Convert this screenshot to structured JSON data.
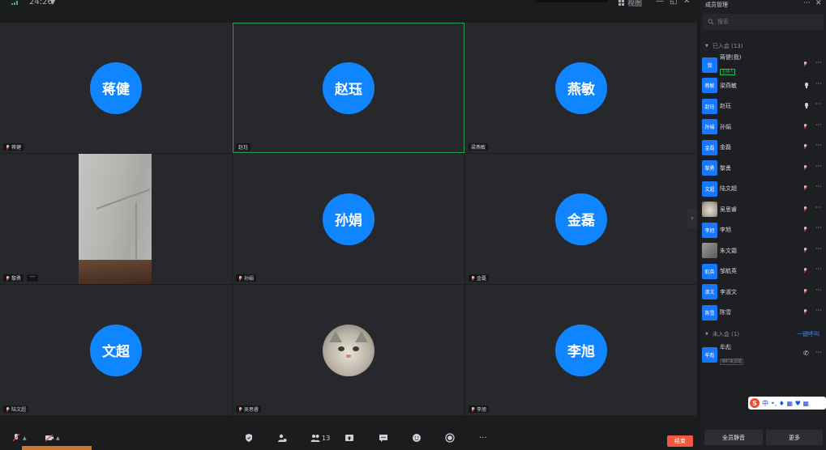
{
  "topbar": {
    "duration": "24:26",
    "view_label": "视图",
    "minimize": "—",
    "restore": "◱",
    "close": "✕"
  },
  "tiles": [
    {
      "name": "蒋健",
      "avatar_text": "蒋健",
      "tag": "蒋健"
    },
    {
      "name": "赵珏",
      "avatar_text": "赵珏",
      "tag": "赵珏"
    },
    {
      "name": "燕敏",
      "avatar_text": "燕敏",
      "tag": "梁燕敏"
    },
    {
      "name": "黎勇",
      "avatar_text": "",
      "tag": "黎勇"
    },
    {
      "name": "孙娟",
      "avatar_text": "孙娟",
      "tag": "孙娟"
    },
    {
      "name": "金磊",
      "avatar_text": "金磊",
      "tag": "金磊"
    },
    {
      "name": "文超",
      "avatar_text": "文超",
      "tag": "陆文超"
    },
    {
      "name": "吴思睿",
      "avatar_text": "",
      "tag": "吴思睿"
    },
    {
      "name": "李旭",
      "avatar_text": "李旭",
      "tag": "李旭"
    }
  ],
  "toolbar": {
    "participants_count": "13",
    "end_label": "结束",
    "more_glyph": "···"
  },
  "panel": {
    "title": "成员管理",
    "more": "···",
    "close": "✕",
    "search_placeholder": "搜索",
    "joined_header": "已入会 (13)",
    "not_joined_header": "未入会 (1)",
    "call_all": "一键呼叫",
    "members": [
      {
        "avatar": "我",
        "name": "蒋健(我)",
        "role": "主持人",
        "mic": "muted"
      },
      {
        "avatar": "燕敏",
        "name": "梁燕敏",
        "role": "",
        "mic": "on"
      },
      {
        "avatar": "赵珏",
        "name": "赵珏",
        "role": "",
        "mic": "on"
      },
      {
        "avatar": "孙娟",
        "name": "孙娟",
        "role": "",
        "mic": "muted"
      },
      {
        "avatar": "金磊",
        "name": "金磊",
        "role": "",
        "mic": "muted"
      },
      {
        "avatar": "黎勇",
        "name": "黎勇",
        "role": "",
        "mic": "muted"
      },
      {
        "avatar": "文超",
        "name": "陆文超",
        "role": "",
        "mic": "muted"
      },
      {
        "avatar": "",
        "name": "吴思睿",
        "role": "",
        "mic": "muted"
      },
      {
        "avatar": "李旭",
        "name": "李旭",
        "role": "",
        "mic": "muted"
      },
      {
        "avatar": "",
        "name": "朱文霜",
        "role": "",
        "mic": "muted"
      },
      {
        "avatar": "航英",
        "name": "邹航英",
        "role": "",
        "mic": "muted"
      },
      {
        "avatar": "淑文",
        "name": "李淑文",
        "role": "",
        "mic": "muted"
      },
      {
        "avatar": "陈雪",
        "name": "陈雪",
        "role": "",
        "mic": "muted"
      }
    ],
    "not_joined": [
      {
        "avatar": "牟彪",
        "name": "牟彪",
        "sub": "绑时来源端"
      }
    ],
    "mute_all_label": "全员静音",
    "more_label": "更多"
  },
  "ime": {
    "s": "S",
    "lang": "中",
    "rest": "•, ♦ ▦ ♥ ▦"
  }
}
